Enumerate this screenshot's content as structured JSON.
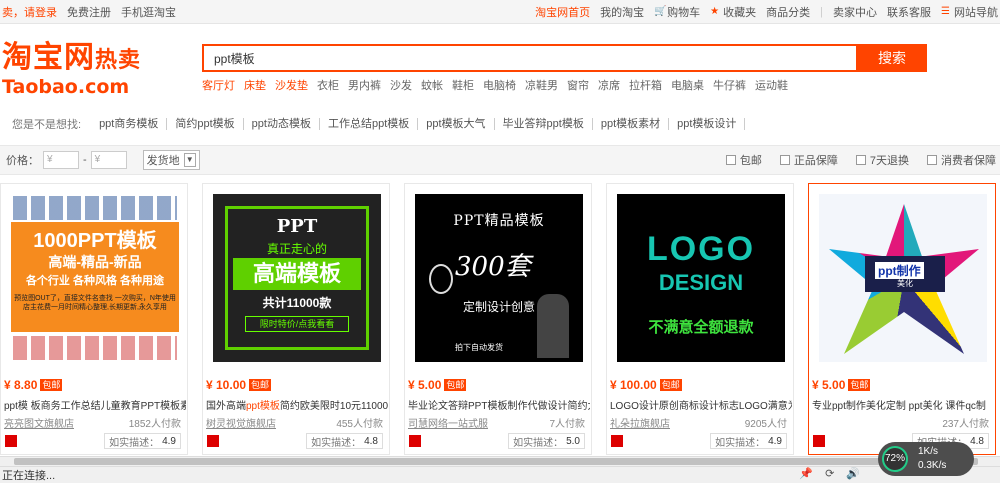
{
  "topbar": {
    "greeting": "卖，请登录",
    "register": "免费注册",
    "mobile": "手机逛淘宝",
    "home": "淘宝网首页",
    "my_taobao": "我的淘宝",
    "cart": "购物车",
    "favorites": "收藏夹",
    "categories": "商品分类",
    "seller_center": "卖家中心",
    "contact": "联系客服",
    "site_nav": "网站导航"
  },
  "logo": {
    "main": "淘宝网",
    "hot": "热卖",
    "sub": "Taobao.com"
  },
  "search": {
    "value": "ppt模板",
    "button": "搜索"
  },
  "hotwords": [
    "客厅灯",
    "床垫",
    "沙发垫",
    "衣柜",
    "男内裤",
    "沙发",
    "蚊帐",
    "鞋柜",
    "电脑椅",
    "凉鞋男",
    "窗帘",
    "凉席",
    "拉杆箱",
    "电脑桌",
    "牛仔裤",
    "运动鞋"
  ],
  "suggest": {
    "label": "您是不是想找:",
    "items": [
      "ppt商务模板",
      "简约ppt模板",
      "ppt动态模板",
      "工作总结ppt模板",
      "ppt模板大气",
      "毕业答辩ppt模板",
      "ppt模板素材",
      "ppt模板设计"
    ]
  },
  "filter": {
    "price_label": "价格：",
    "price_min_placeholder": "¥",
    "dash": "-",
    "price_max_placeholder": "¥",
    "ship_from": "发货地",
    "checks": [
      "包邮",
      "正品保障",
      "7天退换",
      "消费者保障"
    ]
  },
  "products": [
    {
      "price": "¥ 8.80",
      "tag": "包邮",
      "title_pre": "ppt模 板商务工作总结儿童教育PPT模板素",
      "title_hl": "",
      "title_post": "",
      "shop": "亮亮图文旗舰店",
      "buyers": "1852人付款",
      "rate_label": "如实描述：",
      "rate": "4.9",
      "art": {
        "l1": "1000PPT模板",
        "l2": "高端-精品-新品",
        "l3": "各个行业 各种风格 各种用途",
        "l4": "预览图OUT了，直接文件名查找 一次购买，N年使用 店主花费一月时间精心整理,长期更新,永久享用"
      }
    },
    {
      "price": "¥ 10.00",
      "tag": "包邮",
      "title_pre": "国外高端",
      "title_hl": "ppt模板",
      "title_post": "简约欧美限时10元11000",
      "shop": "树灵视觉旗舰店",
      "buyers": "455人付款",
      "rate_label": "如实描述：",
      "rate": "4.8",
      "art": {
        "l1": "PPT",
        "l2": "真正走心的",
        "l3": "高端模板",
        "l4": "共计11000款",
        "l5": "限时特价/点我看看"
      }
    },
    {
      "price": "¥ 5.00",
      "tag": "包邮",
      "title_pre": "毕业论文答辩PPT模板制作代做设计简约大",
      "title_hl": "",
      "title_post": "",
      "shop": "司慧网络一站式服",
      "buyers": "7人付款",
      "rate_label": "如实描述：",
      "rate": "5.0",
      "art": {
        "l1": "PPT精品模板",
        "l2": "300套",
        "l3": "定制设计创意",
        "l4": "拍下自动发货"
      }
    },
    {
      "price": "¥ 100.00",
      "tag": "包邮",
      "title_pre": "LOGO设计原创商标设计标志LOGO满意为",
      "title_hl": "",
      "title_post": "",
      "shop": "礼朵拉旗舰店",
      "buyers": "9205人付",
      "rate_label": "如实描述：",
      "rate": "4.9",
      "art": {
        "l1": "LOGO",
        "l2": "DESIGN",
        "l3": "不满意全额退款"
      }
    },
    {
      "price": "¥ 5.00",
      "tag": "包邮",
      "title_pre": "专业ppt制作美化定制 ppt美化 课件qc制",
      "title_hl": "",
      "title_post": "",
      "shop": "",
      "buyers": "237人付款",
      "rate_label": "如实描述：",
      "rate": "4.8",
      "art": {
        "l1": "ppt制作",
        "l2": "美化"
      }
    }
  ],
  "status": {
    "text": "正在连接...",
    "speed_pct": "72%",
    "up": "1K/s",
    "down": "0.3K/s"
  },
  "colors": {
    "accent": "#ff4400"
  }
}
